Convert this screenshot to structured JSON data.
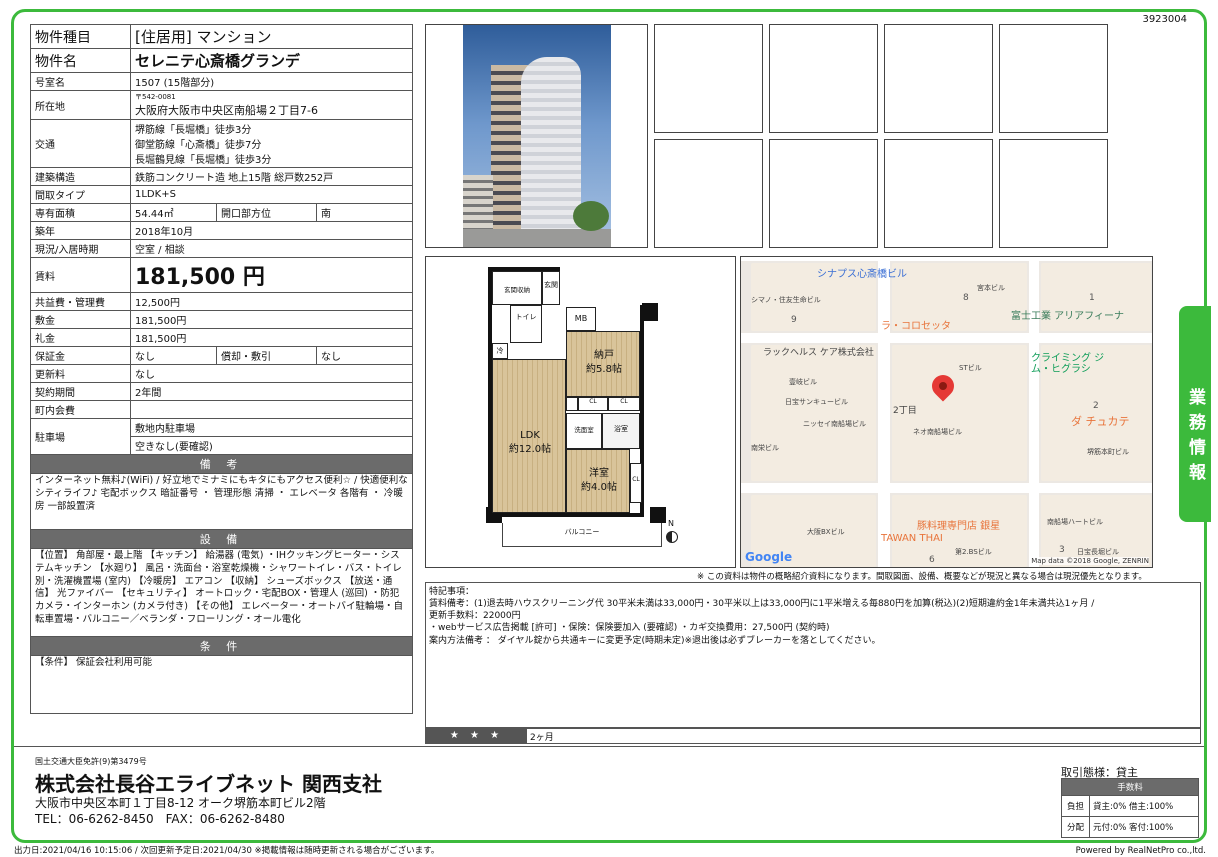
{
  "property_id": "3923004",
  "rows": {
    "type_label": "物件種目",
    "type_value": "[住居用] マンション",
    "name_label": "物件名",
    "name_value": "セレニテ心斎橋グランデ",
    "room_label": "号室名",
    "room_value": "1507 (15階部分)",
    "address_label": "所在地",
    "postal": "〒542-0081",
    "address_value": "大阪府大阪市中央区南船場２丁目7-6",
    "transit_label": "交通",
    "transit": [
      "堺筋線「長堀橋」徒歩3分",
      "御堂筋線「心斎橋」徒歩7分",
      "長堀鶴見線「長堀橋」徒歩3分"
    ],
    "structure_label": "建築構造",
    "structure_value": "鉄筋コンクリート造 地上15階 総戸数252戸",
    "layout_label": "間取タイプ",
    "layout_value": "1LDK+S",
    "area_label": "専有面積",
    "area_value": "54.44㎡",
    "facing_label": "開口部方位",
    "facing_value": "南",
    "built_label": "築年",
    "built_value": "2018年10月",
    "status_label": "現況/入居時期",
    "status_value": "空室 / 相談",
    "rent_label": "賃料",
    "rent_value": "181,500 円",
    "mgmt_label": "共益費・管理費",
    "mgmt_value": "12,500円",
    "deposit_label": "敷金",
    "deposit_value": "181,500円",
    "key_label": "礼金",
    "key_value": "181,500円",
    "guarantee_label": "保証金",
    "guarantee_value": "なし",
    "amort_label": "償却・敷引",
    "amort_value": "なし",
    "renewal_label": "更新料",
    "renewal_value": "なし",
    "contract_label": "契約期間",
    "contract_value": "2年間",
    "town_label": "町内会費",
    "town_value": "",
    "parking_label": "駐車場",
    "parking_value1": "敷地内駐車場",
    "parking_value2": "空きなし(要確認)"
  },
  "remarks": {
    "header": "備 考",
    "text": "インターネット無料♪(WiFi) / 好立地でミナミにもキタにもアクセス便利☆ / 快適便利なシティライフ♪ 宅配ボックス 暗証番号 ・ 管理形態 清掃 ・ エレベータ 各階有 ・ 冷暖房 一部設置済"
  },
  "facilities": {
    "header": "設 備",
    "text": "【位置】 角部屋・最上階 【キッチン】 給湯器 (電気) ・IHクッキングヒーター・システムキッチン 【水廻り】 風呂・洗面台・浴室乾燥機・シャワートイレ・バス・トイレ別・洗濯機置場 (室内) 【冷暖房】 エアコン 【収納】 シューズボックス 【放送・通信】 光ファイバー 【セキュリティ】 オートロック・宅配BOX・管理人 (巡回) ・防犯カメラ・インターホン (カメラ付き) 【その他】 エレベーター・オートバイ駐輪場・自転車置場・バルコニー／ベランダ・フローリング・オール電化"
  },
  "conditions": {
    "header": "条 件",
    "text": "【条件】 保証会社利用可能"
  },
  "floorplan": {
    "entrance_storage": "玄関収納",
    "entrance": "玄関",
    "toilet": "トイレ",
    "mb": "MB",
    "fridge": "冷",
    "storeroom": "納戸",
    "storeroom_size": "約5.8帖",
    "cl": "CL",
    "washroom": "洗面室",
    "bath": "浴室",
    "ldk": "LDK",
    "ldk_size": "約12.0帖",
    "western": "洋室",
    "western_size": "約4.0帖",
    "balcony": "バルコニー",
    "north": "N"
  },
  "map": {
    "labels": [
      "シナプス心斎橋ビル",
      "シマノ・住友生命ビル",
      "宮本ビル",
      "富士工業 アリアフィーナ",
      "ラ・コロセッタ",
      "ラックヘルス ケア株式会社",
      "STビル",
      "クライミング ジム・ヒグラシ",
      "壹岐ビル",
      "日宝サンキュービル",
      "2丁目",
      "ダ チュカテ",
      "ニッセイ南船場ビル",
      "ネオ南船場ビル",
      "南栄ビル",
      "堺筋本町ビル",
      "大阪BXビル",
      "豚料理専門店 銀星",
      "TAWAN THAI",
      "南船場ハートビル",
      "第2.BSビル",
      "日宝長堀ビル"
    ],
    "numbers": [
      "9",
      "8",
      "1",
      "2",
      "6",
      "3"
    ],
    "google": "Google",
    "credit": "Map data ©2018 Google, ZENRIN"
  },
  "disclaimer": "※ この資料は物件の概略紹介資料になります。間取図面、設備、概要などが現況と異なる場合は現況優先となります。",
  "notes": [
    "特記事項：",
    "賃料備考：(1)退去時ハウスクリーニング代 30平米未満は33,000円・30平米以上は33,000円に1平米増える毎880円を加算(税込)(2)短期違約金1年未満共込1ヶ月 /",
    "更新手数料：22000円",
    "・webサービス広告掲載 [許可] ・保険：保険要加入 (要確認) ・カギ交換費用：27,500円 (契約時)",
    "案内方法備考 ： ダイヤル錠から共通キーに変更予定(時期未定)※退出後は必ずブレーカーを落としてください。"
  ],
  "stars": "★ ★ ★",
  "stars_text": "2ヶ月",
  "side_tab": "業務情報",
  "company": {
    "license": "国土交通大臣免許(9)第3479号",
    "name": "株式会社長谷エライブネット 関西支社",
    "address": "大阪市中央区本町１丁目8-12 オーク堺筋本町ビル2階",
    "tel": "TEL：06-6262-8450　FAX：06-6262-8480"
  },
  "deal": {
    "mode": "取引態様：貸主",
    "fee_header": "手数料",
    "burden_label": "負担",
    "burden_value": "貸主:0% 借主:100%",
    "split_label": "分配",
    "split_value": "元付:0% 客付:100%"
  },
  "footer_left": "出力日:2021/04/16 10:15:06 / 次回更新予定日:2021/04/30 ※掲載情報は随時更新される場合がございます。",
  "footer_right": "Powered by RealNetPro co.,ltd.",
  "colors": {
    "accent_green": "#3cba3c",
    "header_gray": "#6b6b6b"
  }
}
